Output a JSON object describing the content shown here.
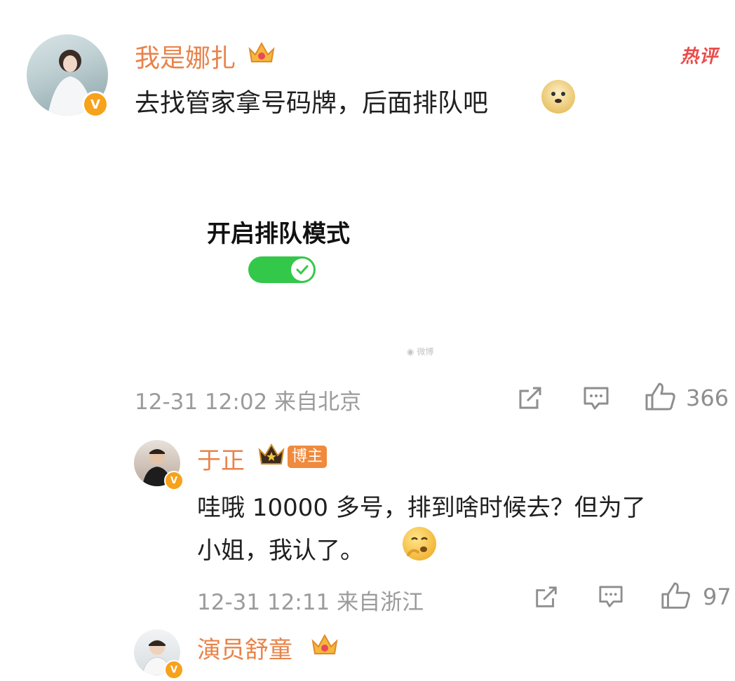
{
  "hot_label": "热评",
  "comment1": {
    "user": "我是娜扎",
    "text": "去找管家拿号码牌，后面排队吧",
    "emoji": "doge-emoji",
    "image": {
      "label": "开启排队模式",
      "toggle_on": true,
      "watermark": "微博"
    },
    "time": "12-31 12:02",
    "location": "来自北京",
    "likes": "366"
  },
  "reply1": {
    "user": "于正",
    "badge": "博主",
    "text_line1": "哇哦 10000 多号，排到啥时候去？但为了",
    "text_line2": "小姐，我认了。",
    "emoji": "thinking-emoji",
    "time": "12-31 12:11",
    "location": "来自浙江",
    "likes": "97"
  },
  "reply2": {
    "user": "演员舒童"
  },
  "colors": {
    "name": "#e8834a",
    "hot": "#ea4b4b",
    "toggle": "#34c84a",
    "meta": "#9b9b9b",
    "verified": "#f7a21b"
  }
}
